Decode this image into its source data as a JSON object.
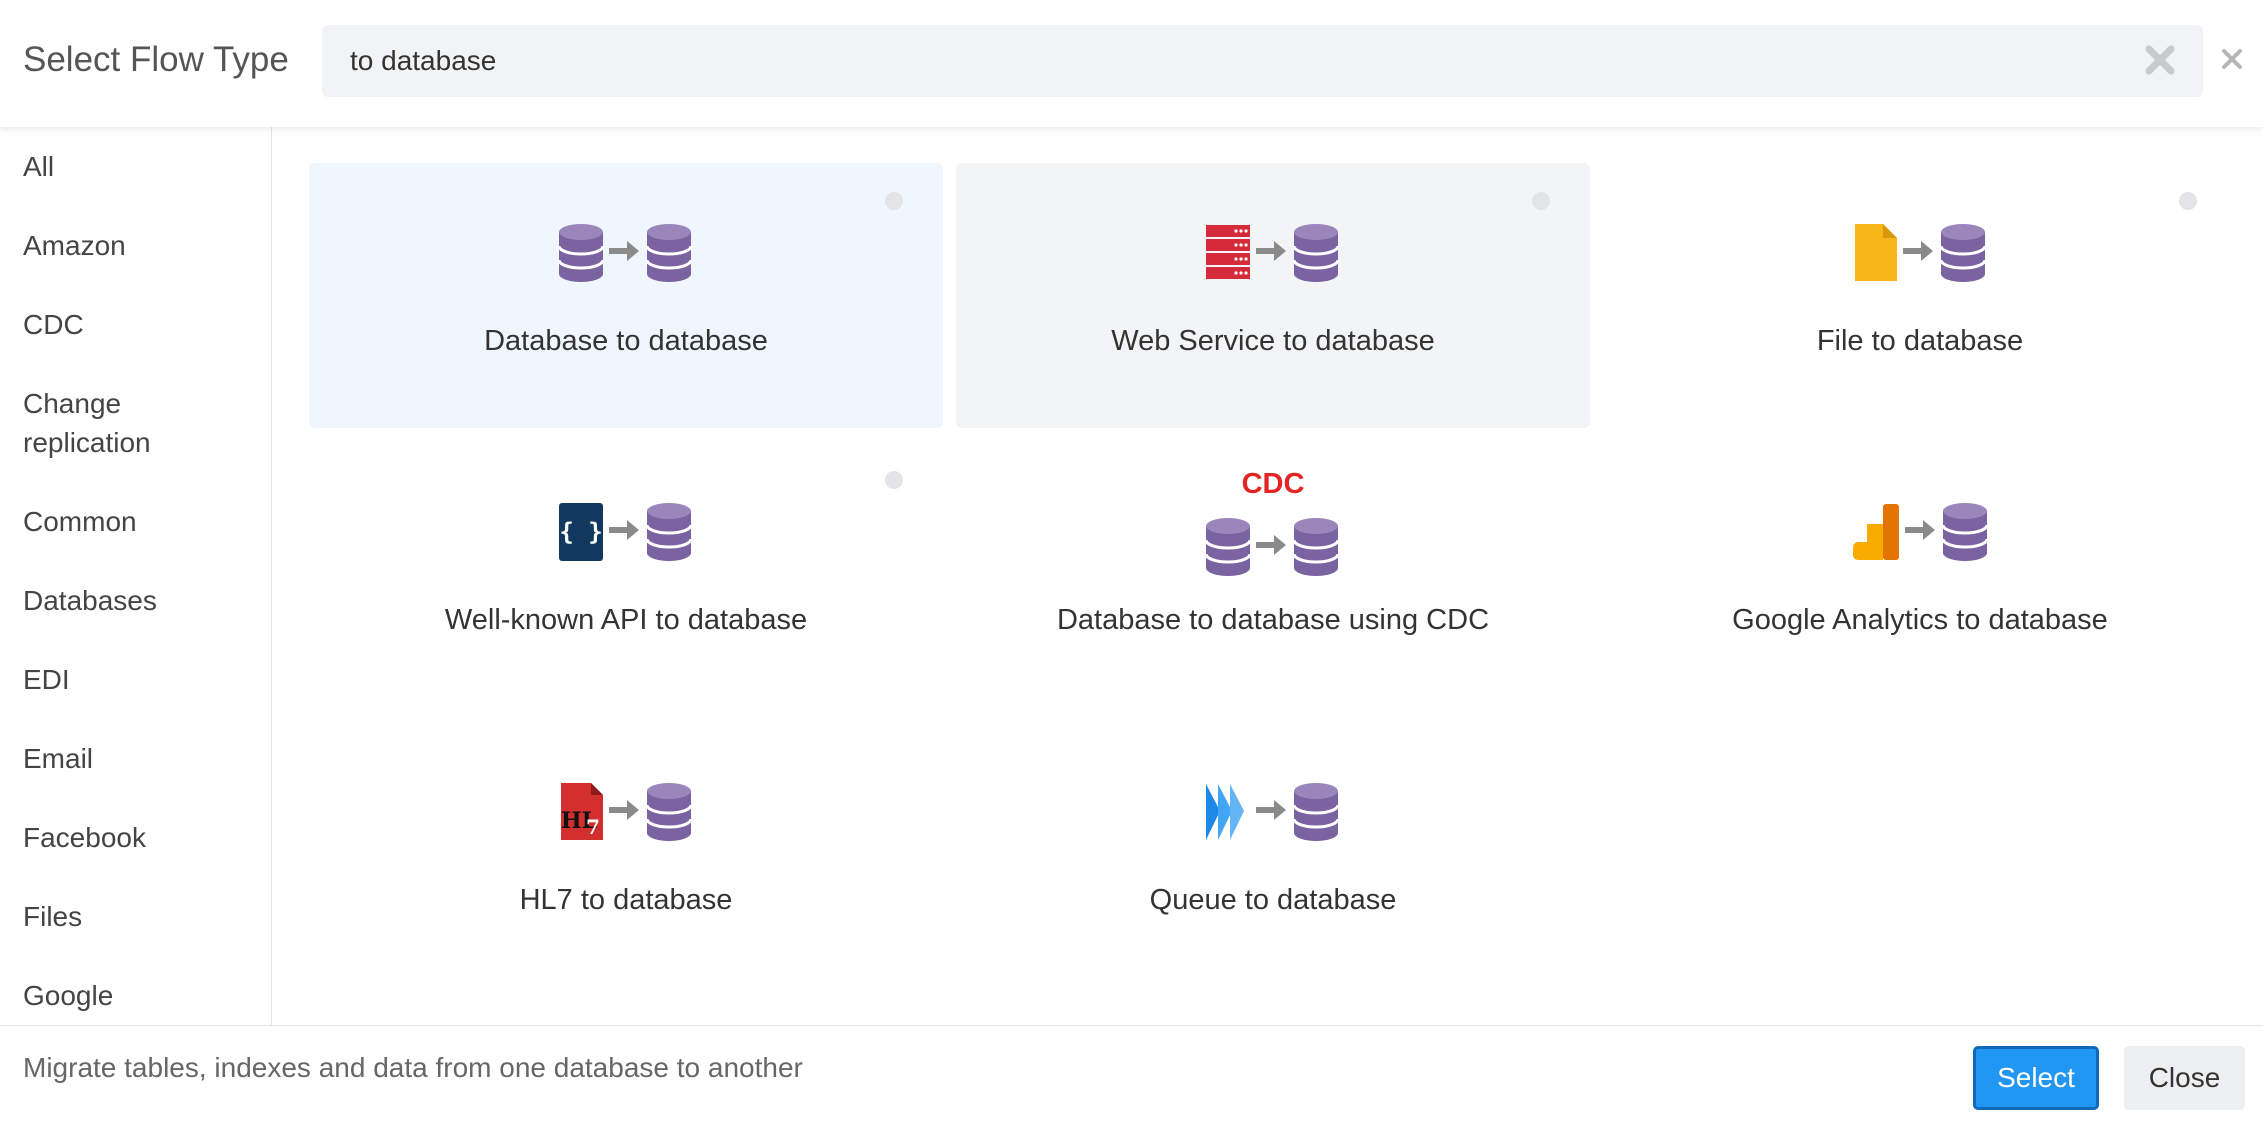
{
  "header": {
    "title": "Select Flow Type",
    "search_value": "to database"
  },
  "sidebar": {
    "items": [
      {
        "label": "All"
      },
      {
        "label": "Amazon"
      },
      {
        "label": "CDC"
      },
      {
        "label": "Change replication"
      },
      {
        "label": "Common"
      },
      {
        "label": "Databases"
      },
      {
        "label": "EDI"
      },
      {
        "label": "Email"
      },
      {
        "label": "Facebook"
      },
      {
        "label": "Files"
      },
      {
        "label": "Google"
      }
    ]
  },
  "flows": [
    {
      "label": "Database to database",
      "icon": "database-to-database-icon",
      "state": "selected"
    },
    {
      "label": "Web Service to database",
      "icon": "web-service-to-database-icon",
      "state": "hover"
    },
    {
      "label": "File to database",
      "icon": "file-to-database-icon",
      "state": "normal"
    },
    {
      "label": "Well-known API to database",
      "icon": "api-to-database-icon",
      "state": "normal"
    },
    {
      "label": "Database to database using CDC",
      "icon": "cdc-database-to-database-icon",
      "badge": "CDC",
      "state": "normal"
    },
    {
      "label": "Google Analytics to database",
      "icon": "google-analytics-to-database-icon",
      "state": "normal"
    },
    {
      "label": "HL7 to database",
      "icon": "hl7-to-database-icon",
      "state": "normal"
    },
    {
      "label": "Queue to database",
      "icon": "queue-to-database-icon",
      "state": "normal"
    }
  ],
  "footer": {
    "description": "Migrate tables, indexes and data from one database to another",
    "select_label": "Select",
    "close_label": "Close"
  },
  "colors": {
    "accent": "#2196f3",
    "database": "#7b62a0",
    "cdc": "#e32424",
    "selected_bg": "#eff6fd"
  }
}
